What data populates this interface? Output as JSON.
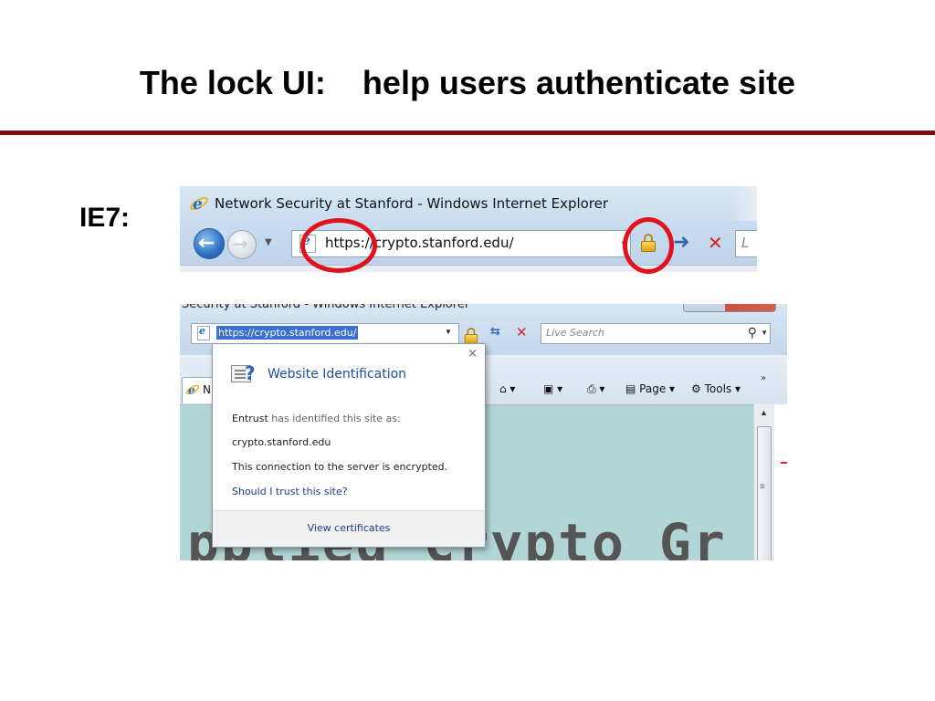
{
  "slide": {
    "title": "The lock UI:    help users authenticate site",
    "label": "IE7:",
    "colors": {
      "title_rule": "#7b0d0d",
      "annotation": "#e0121b"
    }
  },
  "screenshot1": {
    "window_title": "Network Security at Stanford - Windows Internet Explorer",
    "address_url": "https://crypto.stanford.edu/",
    "search_stub": "L",
    "icons": [
      "ie-logo-icon",
      "back-icon",
      "forward-icon",
      "page-icon",
      "lock-icon",
      "go-arrow-icon",
      "stop-icon"
    ]
  },
  "screenshot2": {
    "partial_window_title": "Security at Stanford - Windows Internet Explorer",
    "address_url": "https://crypto.stanford.edu/",
    "search_placeholder": "Live Search",
    "tab_label_partial": "N",
    "commands": {
      "page": "Page",
      "tools": "Tools"
    },
    "background_text_partial": "pplied Crypto Gr",
    "popup": {
      "heading": "Website Identification",
      "issuer": "Entrust",
      "issuer_suffix": "has identified this site as:",
      "identified_site": "crypto.stanford.edu",
      "encryption_note": "This connection to the server is encrypted.",
      "trust_link": "Should I trust this site?",
      "view_certificates": "View certificates",
      "close_glyph": "×"
    }
  }
}
